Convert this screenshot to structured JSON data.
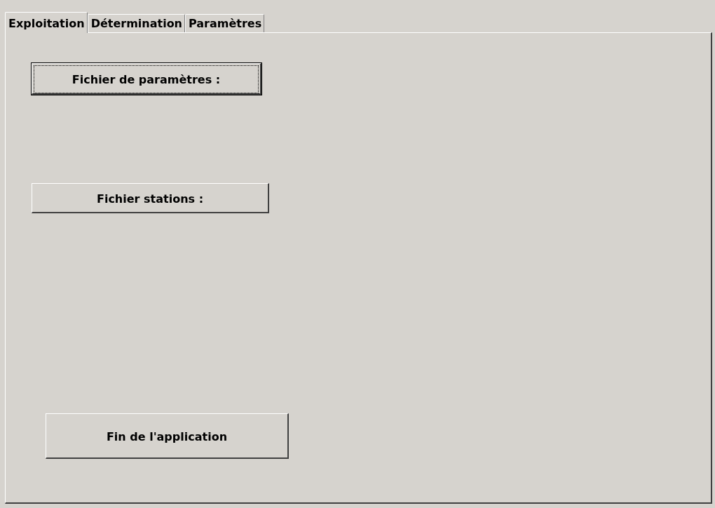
{
  "tabs": [
    {
      "label": "Exploitation",
      "selected": true
    },
    {
      "label": "Détermination",
      "selected": false
    },
    {
      "label": "Paramètres",
      "selected": false
    }
  ],
  "buttons": [
    {
      "label": "Fichier de paramètres :",
      "focused": true
    },
    {
      "label": "Fichier stations :",
      "focused": false
    },
    {
      "label": "Fin de l'application",
      "focused": false
    }
  ]
}
